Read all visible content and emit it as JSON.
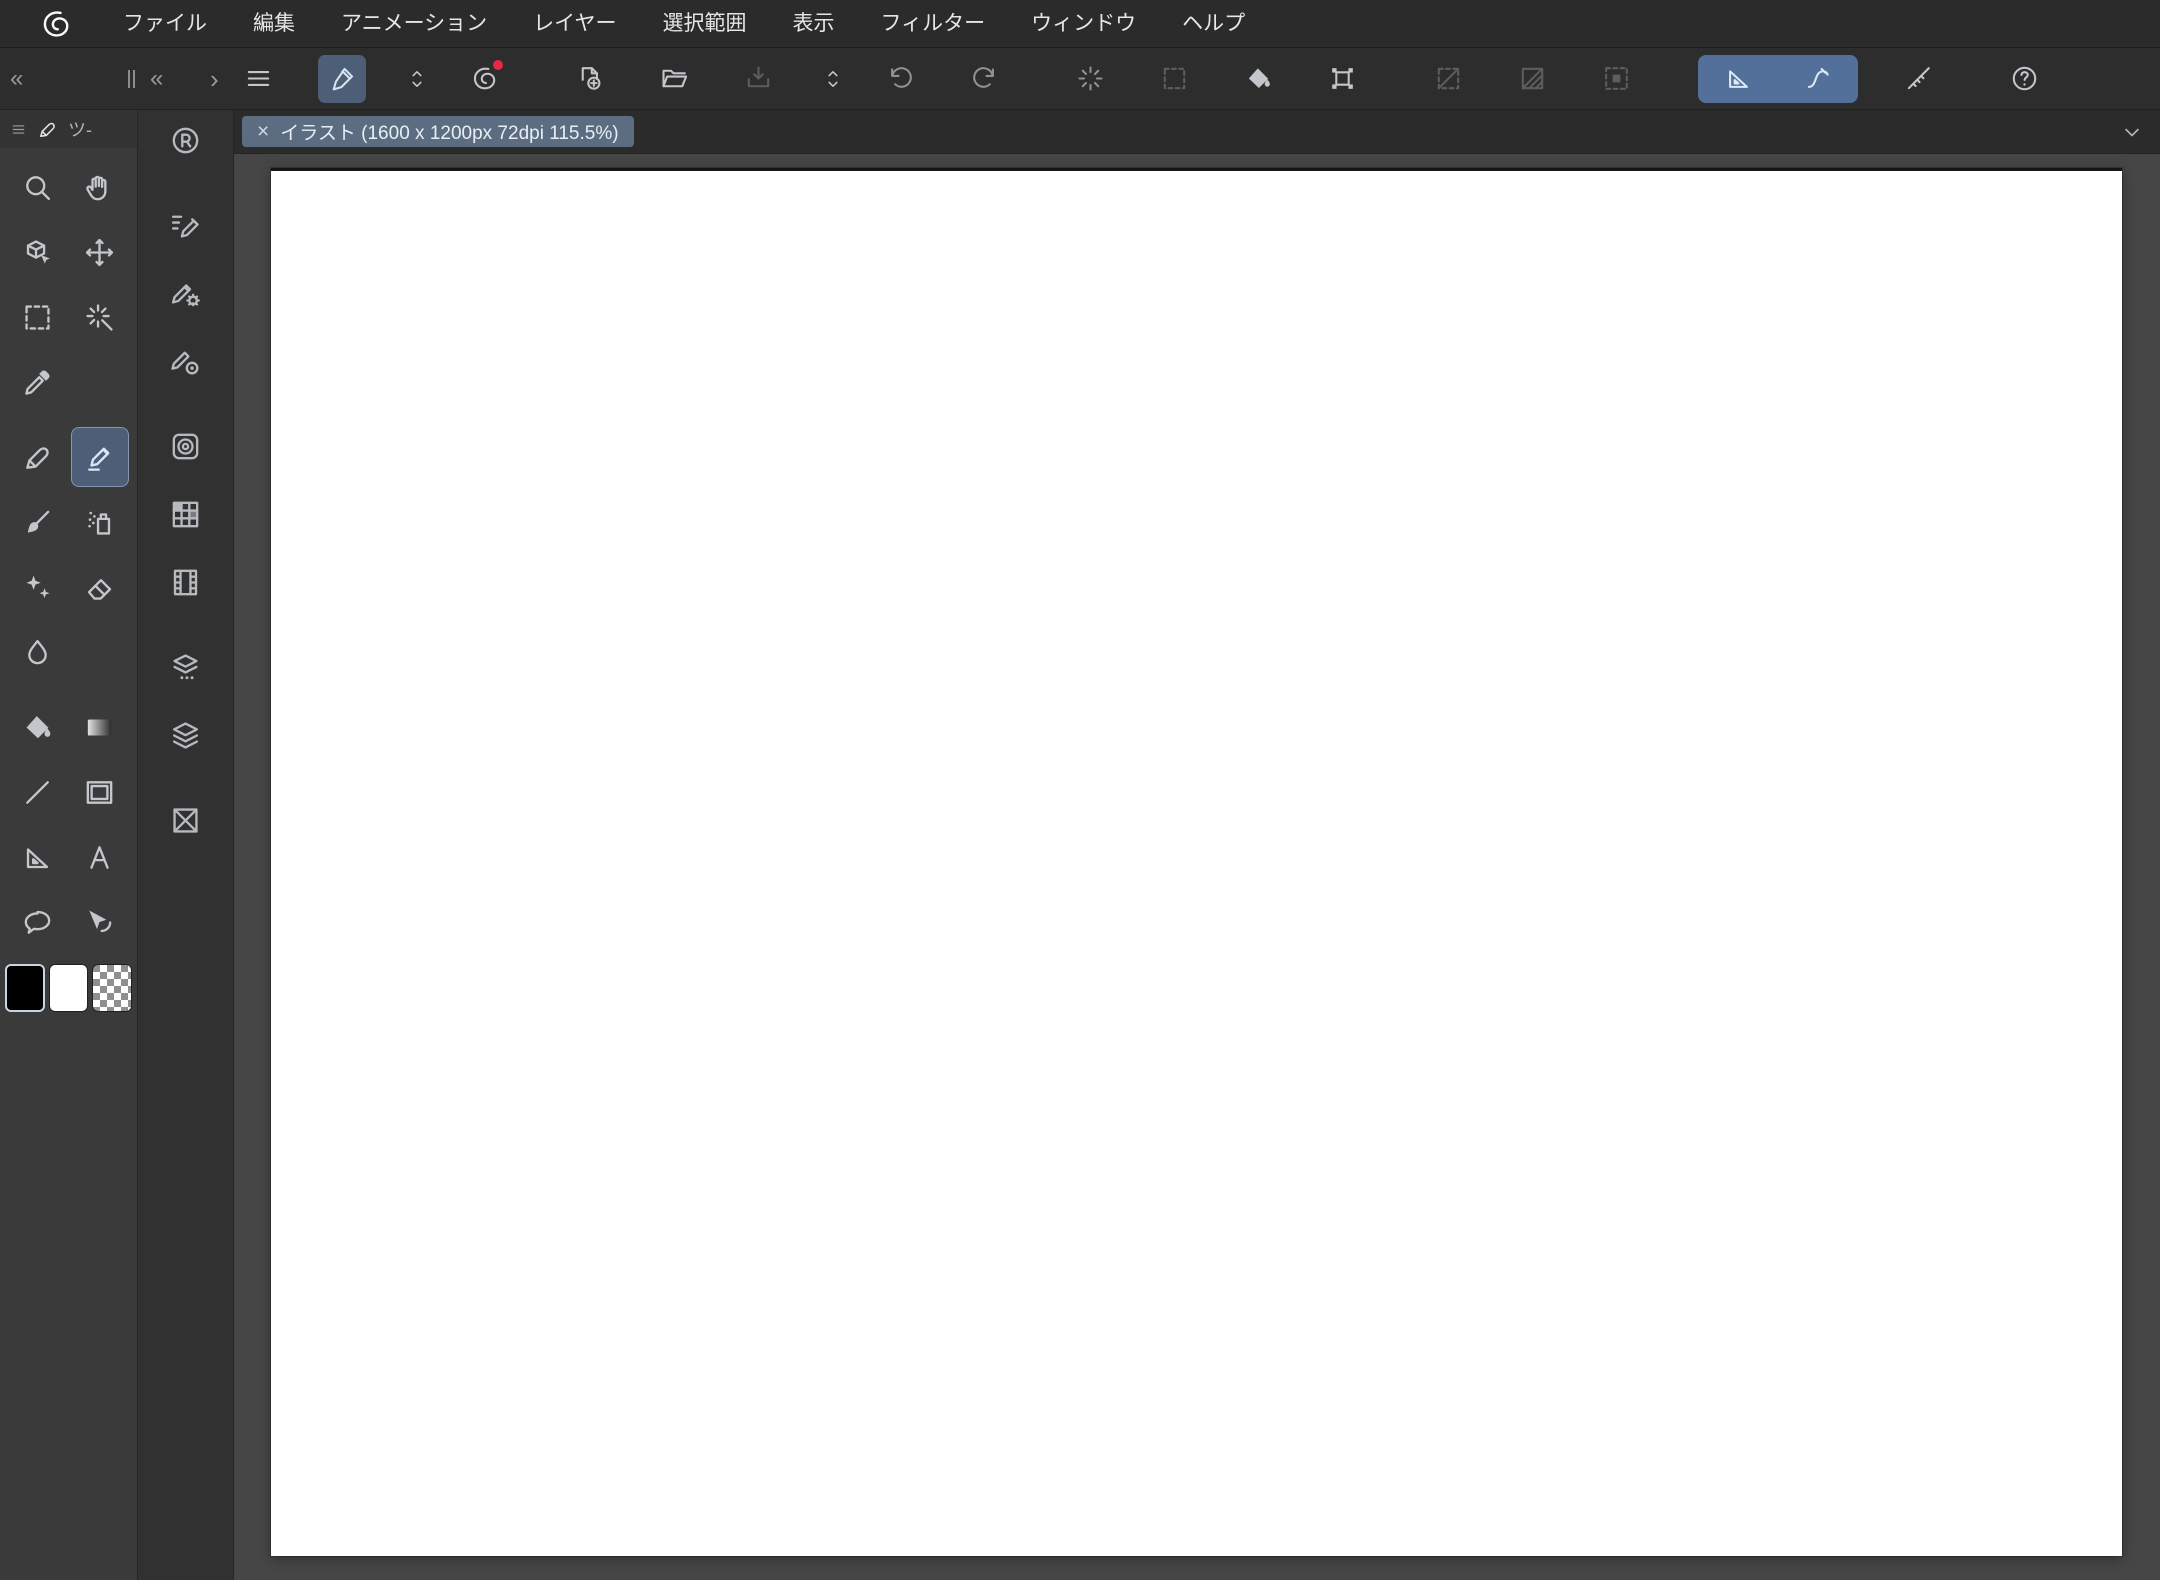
{
  "app": {
    "name": "CLIP STUDIO PAINT"
  },
  "colors": {
    "menubar_bg": "#2b2b2b",
    "toolbar_bg": "#2d2d2d",
    "palette_bg": "#3a3a3a",
    "palette_header_bg": "#333333",
    "dock_bg": "#313131",
    "tabbar_bg": "#2b2b2b",
    "canvas_area_bg": "#464646",
    "canvas_bg": "#ffffff",
    "accent": "#4d5f77",
    "accent_bright": "#52709a",
    "icon": "#c3c7cc",
    "icon_dim": "#8f9295",
    "icon_disabled": "#5d5d5d",
    "text": "#e2e2e2",
    "tab_bg": "#5c6d82",
    "tab_text": "#e9eef5",
    "badge_red": "#e8274b"
  },
  "menubar": {
    "items": [
      "ファイル",
      "編集",
      "アニメーション",
      "レイヤー",
      "選択範囲",
      "表示",
      "フィルター",
      "ウィンドウ",
      "ヘルプ"
    ]
  },
  "collapse_controls": {
    "collapse_tool_palette": "«",
    "collapse_dock": "«",
    "expand_dock": "›"
  },
  "toolbar": {
    "buttons": [
      {
        "name": "main-menu",
        "icon": "hamburger"
      },
      {
        "name": "pen-input-settings",
        "icon": "pen-cursor",
        "state": "selected"
      },
      {
        "name": "command-bar-collapse",
        "icon": "chevron-updown",
        "narrow": true
      },
      {
        "name": "open-clip-studio",
        "icon": "clipstudio",
        "badge": true
      },
      {
        "name": "new-canvas",
        "icon": "new-file",
        "gap": true
      },
      {
        "name": "open-file",
        "icon": "open-folder"
      },
      {
        "name": "save-file",
        "icon": "save",
        "state": "disabled"
      },
      {
        "name": "save-menu-collapse",
        "icon": "chevron-updown",
        "narrow": true
      },
      {
        "name": "undo",
        "icon": "undo",
        "state": "dim"
      },
      {
        "name": "redo",
        "icon": "redo",
        "state": "dim"
      },
      {
        "name": "deselect",
        "icon": "burst",
        "state": "dim",
        "gap": true
      },
      {
        "name": "reselect",
        "icon": "dashed-square",
        "state": "disabled"
      },
      {
        "name": "fill-selection",
        "icon": "bucket"
      },
      {
        "name": "scale-rotate",
        "icon": "transform-frame"
      },
      {
        "name": "clear-selection",
        "icon": "mask-off",
        "state": "disabled",
        "gap": true
      },
      {
        "name": "quick-mask",
        "icon": "mask-half",
        "state": "disabled"
      },
      {
        "name": "selection-launcher",
        "icon": "selection-area",
        "state": "disabled"
      },
      {
        "name": "snap-to-ruler",
        "icon": "triangle-ruler",
        "state": "selected",
        "join": "j1",
        "gap": true
      },
      {
        "name": "snap-to-special-ruler",
        "icon": "curve-ruler",
        "state": "selected",
        "join": "j2"
      },
      {
        "name": "snap-to-guide",
        "icon": "guide-ruler"
      },
      {
        "name": "help",
        "icon": "help",
        "gap": true
      }
    ]
  },
  "tool_palette": {
    "header": {
      "title": "ツ-",
      "icons": [
        "hamburger",
        "pen"
      ]
    },
    "tools": [
      {
        "name": "zoom",
        "icon": "magnifier"
      },
      {
        "name": "move-screen",
        "icon": "hand"
      },
      {
        "name": "operate-object",
        "icon": "object-cube"
      },
      {
        "name": "move-layer",
        "icon": "move-arrows"
      },
      {
        "name": "select-area",
        "icon": "dashed-square"
      },
      {
        "name": "auto-select",
        "icon": "wand"
      },
      {
        "name": "eyedropper",
        "icon": "eyedropper"
      },
      null,
      {
        "name": "pen",
        "icon": "pen",
        "mt": true
      },
      {
        "name": "marker",
        "icon": "marker",
        "state": "selected",
        "mt": true
      },
      {
        "name": "brush",
        "icon": "brush"
      },
      {
        "name": "airbrush",
        "icon": "airbrush"
      },
      {
        "name": "decoration",
        "icon": "sparkles"
      },
      {
        "name": "eraser",
        "icon": "eraser"
      },
      {
        "name": "blend",
        "icon": "water-drop"
      },
      null,
      {
        "name": "fill",
        "icon": "bucket",
        "mt": true
      },
      {
        "name": "gradient",
        "icon": "gradient-square",
        "mt": true
      },
      {
        "name": "figure",
        "icon": "line"
      },
      {
        "name": "frame-border",
        "icon": "frame"
      },
      {
        "name": "ruler",
        "icon": "triangle-ruler"
      },
      {
        "name": "text",
        "icon": "text-a"
      },
      {
        "name": "balloon",
        "icon": "speech-balloon"
      },
      {
        "name": "correct-line",
        "icon": "correct-line"
      }
    ],
    "swatches": [
      {
        "name": "main-color",
        "value": "#000000",
        "state": "selected"
      },
      {
        "name": "sub-color",
        "value": "#ffffff"
      },
      {
        "name": "transparent-color",
        "value": "checker"
      }
    ]
  },
  "palette_dock": {
    "items": [
      {
        "name": "quick-access",
        "icon": "circle-r"
      },
      {
        "name": "sub-tool",
        "icon": "pen-list",
        "gap": true
      },
      {
        "name": "tool-property",
        "icon": "pen-gear"
      },
      {
        "name": "brush-size",
        "icon": "pen-circle"
      },
      {
        "name": "color-wheel",
        "icon": "color-wheel",
        "gap": true
      },
      {
        "name": "color-set",
        "icon": "color-grid"
      },
      {
        "name": "timeline",
        "icon": "film-strip"
      },
      {
        "name": "layer-property",
        "icon": "layers-dots",
        "gap": true
      },
      {
        "name": "layer",
        "icon": "layers"
      },
      {
        "name": "navigator",
        "icon": "box-x",
        "gap": true
      }
    ]
  },
  "document": {
    "tab_close": "×",
    "tab_label": "イラスト (1600 x 1200px 72dpi 115.5%)"
  }
}
